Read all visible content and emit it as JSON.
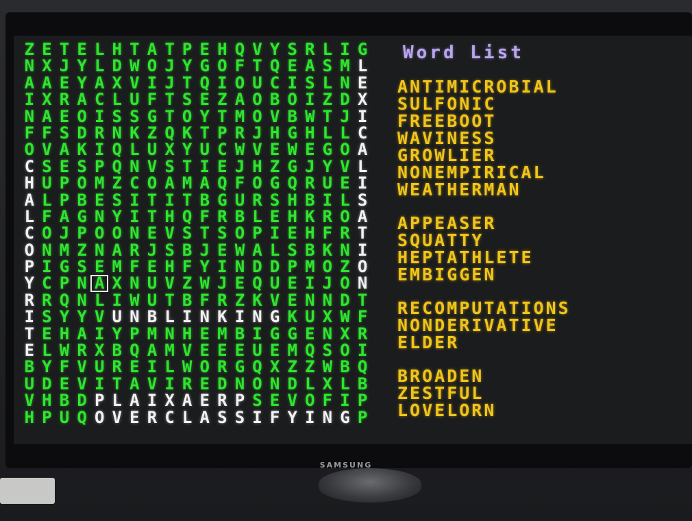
{
  "grid": [
    "ZETELHTATPEHQVYSRLIG",
    "NXJYLDWOJYGOFTQEASML",
    "AAEYAXVIJTQIOUCISLNE",
    "IXRACLUFTSEZAOBOIZDX",
    "NAEOISSGTOYTMOVBWTJI",
    "FFSDRNKZQKTPRJHGHLLC",
    "OVAKIQLUXYUCWVEWEGOA",
    "CSESPQNVSTIEJHZGJYVL",
    "HUPOMZCOAMAQFOGQRUEI",
    "ALPBESITITBGURSHBILS",
    "LFAGNYITHQFRBLEHKROA",
    "COJPOONEVSTSOPIEHFRT",
    "ONMZNARJSBJEWALSBKNI",
    "PIGSEMFEHFYINDDPMOZO",
    "YCPNAXNUVZWJEQUEIJON",
    "RRQNLIWUTBFRZKVENNDT",
    "ISYYVUNBLINKINGKUXWF",
    "TEHAIYPMNHEMBIGGENXR",
    "ELWRXBQAMVEEEUEMQSOI",
    "BYFVUREILWORGQXZZWBQ",
    "UDEVITAVIREDNONDLXLB",
    "VHBDPLAIXAERPSEVOFIP",
    "HPUQOVERCLASSIFYINGP"
  ],
  "word_list_title": "Word List",
  "word_groups": [
    [
      "ANTIMICROBIAL",
      "SULFONIC",
      "FREEBOOT",
      "WAVINESS",
      "GROWLIER",
      "NONEMPIRICAL",
      "WEATHERMAN"
    ],
    [
      "APPEASER",
      "SQUATTY",
      "HEPTATHLETE",
      "EMBIGGEN"
    ],
    [
      "RECOMPUTATIONS",
      "NONDERIVATIVE",
      "ELDER"
    ],
    [
      "BROADEN",
      "ZESTFUL",
      "LOVELORN"
    ]
  ],
  "tv_brand": "SAMSUNG",
  "colors": {
    "grid_letter": "#2fe52f",
    "found_letter": "#f2f2f2",
    "word_list_title": "#b9a6f2",
    "word": "#f0c419",
    "screen_background": "#1b1c1d"
  }
}
